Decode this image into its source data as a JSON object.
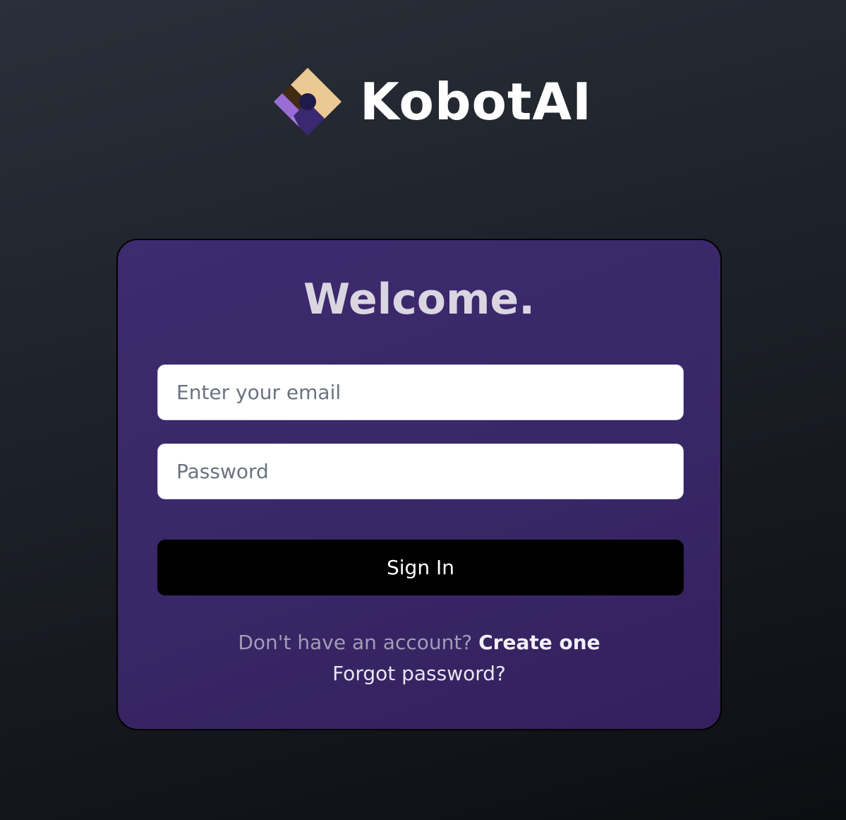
{
  "brand": {
    "name": "KobotAI",
    "logo_icon": "diamond-logo-icon"
  },
  "card": {
    "title": "Welcome."
  },
  "form": {
    "email": {
      "value": "",
      "placeholder": "Enter your email"
    },
    "password": {
      "value": "",
      "placeholder": "Password"
    },
    "submit_label": "Sign In"
  },
  "footer": {
    "signup_prompt": "Don't have an account?",
    "signup_link": "Create one",
    "forgot_link": "Forgot password?"
  },
  "colors": {
    "card_background": "#3b2a6c",
    "button_background": "#000000",
    "logo_tan": "#ebc992",
    "logo_brown": "#3f2a14",
    "logo_purple": "#a878e0",
    "logo_dark_purple": "#3a2870"
  }
}
